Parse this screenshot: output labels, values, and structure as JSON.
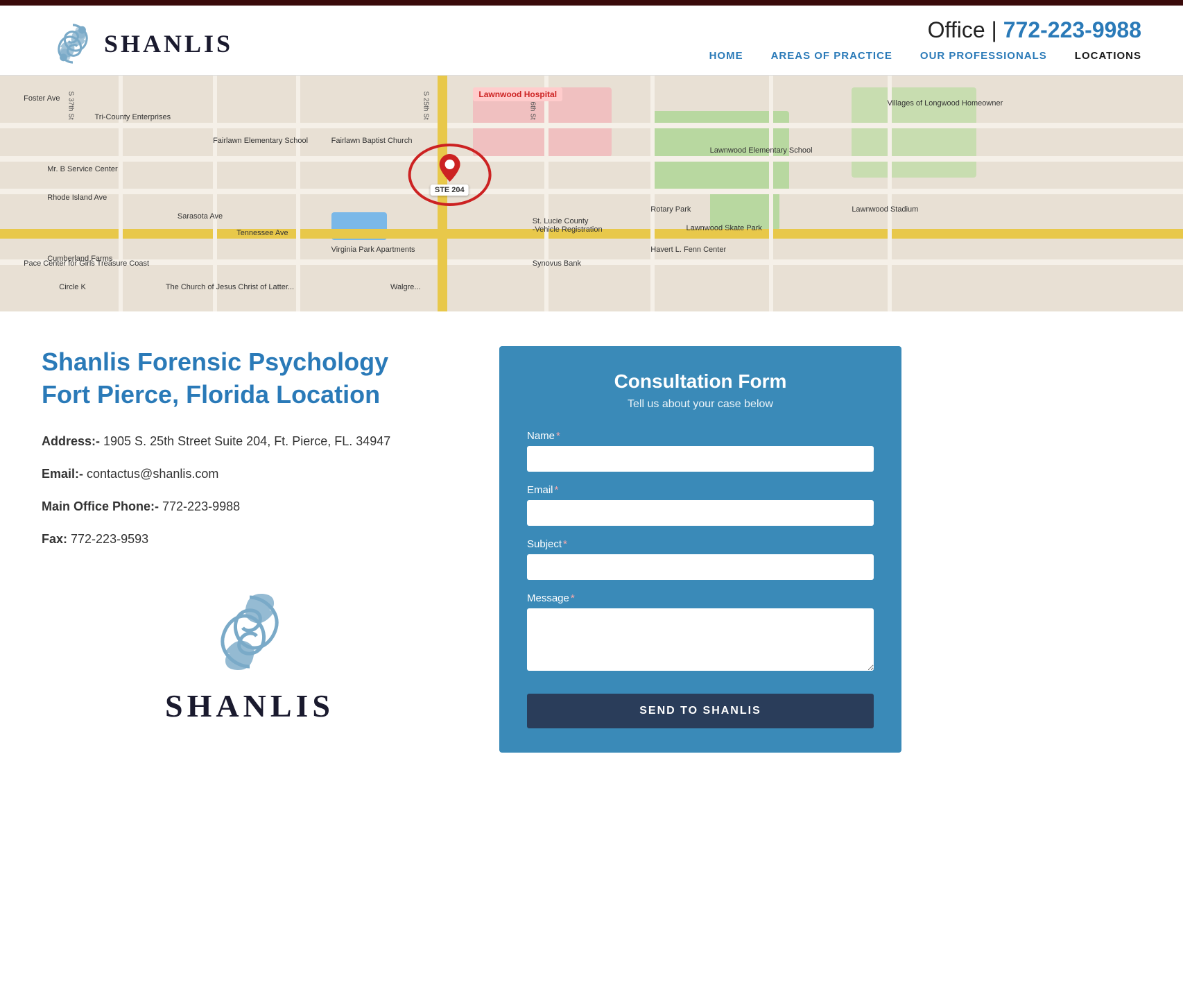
{
  "topbar": {},
  "header": {
    "logo_text": "SHANLIS",
    "phone_prefix": "Office | ",
    "phone_number": "772-223-9988",
    "nav": {
      "items": [
        {
          "label": "HOME",
          "active": false
        },
        {
          "label": "AREAS OF PRACTICE",
          "active": false
        },
        {
          "label": "OUR PROFESSIONALS",
          "active": false
        },
        {
          "label": "LOCATIONS",
          "active": true
        }
      ]
    }
  },
  "map": {
    "marker_label": "STE 204",
    "hospital_label": "Lawnwood Hospital"
  },
  "location": {
    "title_line1": "Shanlis Forensic Psychology",
    "title_line2": "Fort Pierce, Florida Location",
    "address_label": "Address:-",
    "address_value": " 1905 S. 25th Street Suite 204, Ft. Pierce, FL. 34947",
    "email_label": "Email:-",
    "email_value": " contactus@shanlis.com",
    "phone_label": "Main Office Phone:-",
    "phone_value": " 772-223-9988",
    "fax_label": "Fax:",
    "fax_value": " 772-223-9593",
    "logo_text": "SHANLIS"
  },
  "form": {
    "title": "Consultation Form",
    "subtitle": "Tell us about your case below",
    "name_label": "Name",
    "email_label": "Email",
    "subject_label": "Subject",
    "message_label": "Message",
    "submit_label": "SEND TO SHANLIS",
    "name_placeholder": "",
    "email_placeholder": "",
    "subject_placeholder": "",
    "message_placeholder": ""
  }
}
